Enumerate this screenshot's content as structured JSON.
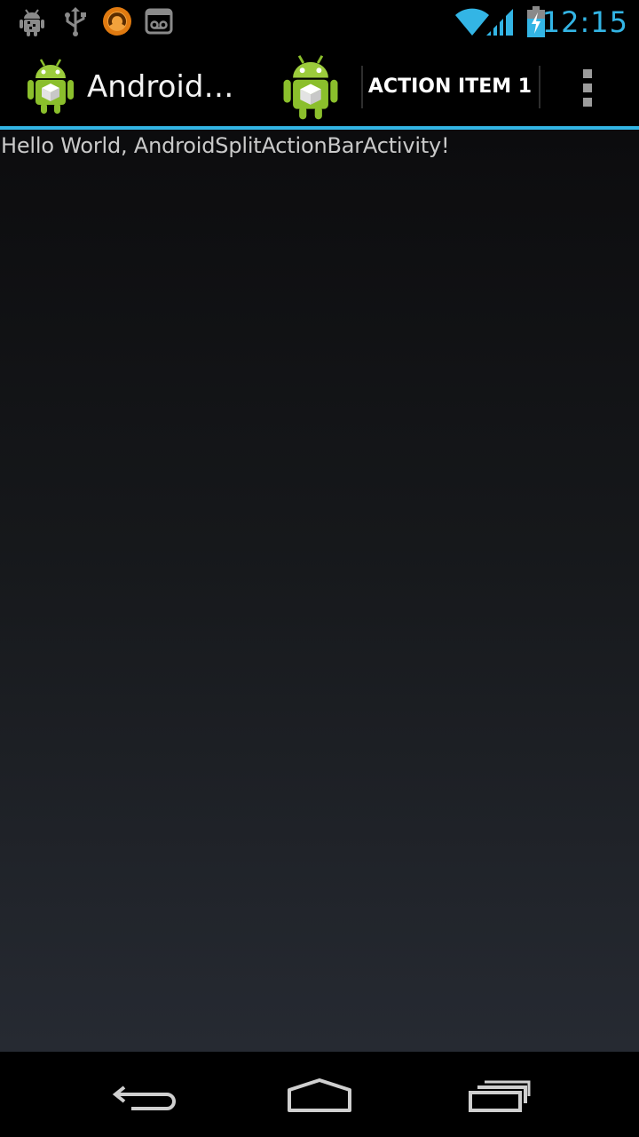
{
  "status_bar": {
    "time": "12:15",
    "notification_icons": [
      "android-debug-icon",
      "usb-icon",
      "orange-app-notification-icon",
      "voicemail-icon"
    ],
    "system_icons": [
      "wifi-icon",
      "cell-signal-icon",
      "battery-charging-icon"
    ],
    "accent_color": "#33b5e5"
  },
  "action_bar": {
    "title": "Android…",
    "action_icon": "android-robot-icon",
    "action_item_label": "ACTION ITEM 1",
    "overflow_icon": "overflow-menu-icon",
    "accent_color": "#33b5e5"
  },
  "content": {
    "text": "Hello World, AndroidSplitActionBarActivity!"
  },
  "nav_bar": {
    "buttons": [
      "back-icon",
      "home-icon",
      "recent-apps-icon"
    ]
  }
}
